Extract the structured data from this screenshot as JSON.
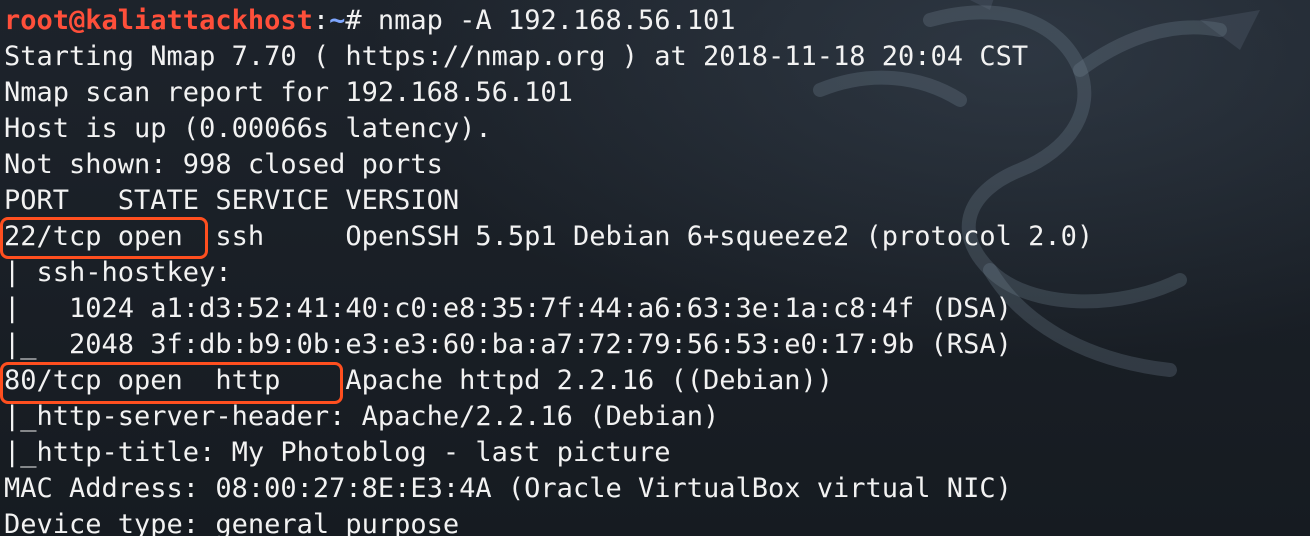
{
  "terminal": {
    "prompt": {
      "user_host": "root@kaliattackhost",
      "colon": ":",
      "path": "~",
      "symbol": "# ",
      "command": "nmap -A 192.168.56.101"
    },
    "lines": [
      "Starting Nmap 7.70 ( https://nmap.org ) at 2018-11-18 20:04 CST",
      "Nmap scan report for 192.168.56.101",
      "Host is up (0.00066s latency).",
      "Not shown: 998 closed ports",
      "PORT   STATE SERVICE VERSION",
      "22/tcp open  ssh     OpenSSH 5.5p1 Debian 6+squeeze2 (protocol 2.0)",
      "| ssh-hostkey: ",
      "|   1024 a1:d3:52:41:40:c0:e8:35:7f:44:a6:63:3e:1a:c8:4f (DSA)",
      "|_  2048 3f:db:b9:0b:e3:e3:60:ba:a7:72:79:56:53:e0:17:9b (RSA)",
      "80/tcp open  http    Apache httpd 2.2.16 ((Debian))",
      "|_http-server-header: Apache/2.2.16 (Debian)",
      "|_http-title: My Photoblog - last picture",
      "MAC Address: 08:00:27:8E:E3:4A (Oracle VirtualBox virtual NIC)",
      "Device type: general purpose"
    ],
    "highlight_color": "#ff4f1f",
    "prompt_user_color": "#ff4f3a",
    "prompt_path_color": "#7fa7ff",
    "background_icon": "kali-dragon-watermark-icon"
  }
}
